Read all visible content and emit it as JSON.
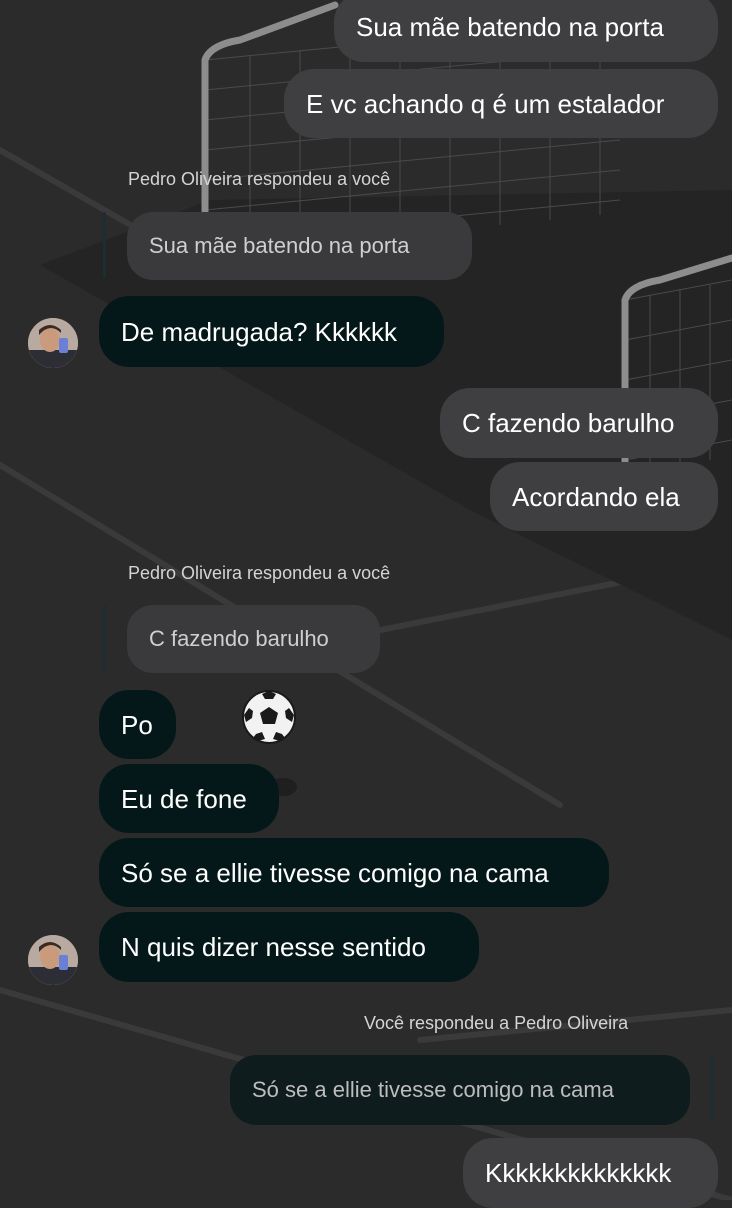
{
  "conversation": {
    "contact": "Pedro Oliveira",
    "messages": [
      {
        "id": "m1",
        "text": "Sua mãe batendo na porta",
        "sender": "me"
      },
      {
        "id": "m2",
        "text": "E vc achando q é um estalador",
        "sender": "me"
      },
      {
        "id": "m3",
        "text": "De madrugada? Kkkkkk",
        "sender": "contact",
        "reply_caption": "Pedro Oliveira respondeu a você",
        "reply_to": "Sua mãe batendo na porta"
      },
      {
        "id": "m4",
        "text": "C fazendo barulho",
        "sender": "me"
      },
      {
        "id": "m5",
        "text": "Acordando ela",
        "sender": "me"
      },
      {
        "id": "m6",
        "text": "Po",
        "sender": "contact",
        "reply_caption": "Pedro Oliveira respondeu a você",
        "reply_to": "C fazendo barulho"
      },
      {
        "id": "m7",
        "text": "Eu de fone",
        "sender": "contact"
      },
      {
        "id": "m8",
        "text": "Só se a ellie tivesse comigo na cama",
        "sender": "contact"
      },
      {
        "id": "m9",
        "text": "N quis dizer nesse sentido",
        "sender": "contact"
      },
      {
        "id": "m10",
        "text": "Kkkkkkkkkkkkkk",
        "sender": "me",
        "reply_caption": "Você respondeu a Pedro Oliveira",
        "reply_to": "Só se a ellie tivesse comigo na cama"
      }
    ]
  },
  "theme": {
    "background": "#2b2b2b",
    "outgoing_bubble": "#3f3f41",
    "incoming_bubble": "#04181a",
    "text": "#ffffff",
    "background_art": "soccer-goal-pitch-illustration",
    "sticker": "soccer-ball-icon"
  }
}
